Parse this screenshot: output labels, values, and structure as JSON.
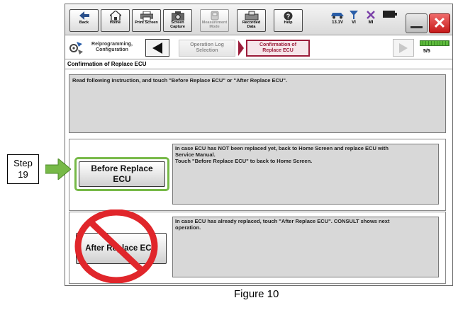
{
  "toolbar": {
    "buttons": [
      {
        "label": "Back",
        "icon": "back-arrow-icon"
      },
      {
        "label": "Home",
        "icon": "home-icon"
      },
      {
        "label": "Print Screen",
        "icon": "printer-icon"
      },
      {
        "label": "Screen\nCapture",
        "icon": "camera-icon"
      },
      {
        "label": "Measurement\nMode",
        "icon": "measurement-icon"
      },
      {
        "label": "Recorded\nData",
        "icon": "recorded-data-icon"
      },
      {
        "label": "Help",
        "icon": "help-icon"
      }
    ],
    "status": {
      "battery_voltage": "13.1V",
      "vi_label": "VI",
      "mi_label": "MI"
    },
    "close_glyph": "✕"
  },
  "breadcrumb": {
    "reprogramming_label": "Re/programming,\nConfiguration",
    "operation_log_label": "Operation Log\nSelection",
    "confirmation_label": "Confirmation of\nReplace ECU",
    "page_count": "5/5",
    "progress_fraction": 1.0
  },
  "page_title": "Confirmation of Replace ECU",
  "instruction_text": "Read following instruction, and touch \"Before Replace ECU\" or \"After Replace ECU\".",
  "before_panel": {
    "button_label": "Before Replace\nECU",
    "description": "In case ECU has NOT been replaced yet, back to Home Screen and replace ECU with\nService  Manual.\nTouch \"Before Replace ECU\" to back to Home Screen."
  },
  "after_panel": {
    "button_label": "After Replace ECU",
    "description": "In case ECU has already replaced, touch \"After Replace ECU\". CONSULT shows next\noperation."
  },
  "step_callout": {
    "label": "Step\n19"
  },
  "colors": {
    "highlight_green": "#77b948",
    "prohibit_red": "#e0262b",
    "breadcrumb_active": "#9b1c3a"
  },
  "figure_caption": "Figure 10"
}
